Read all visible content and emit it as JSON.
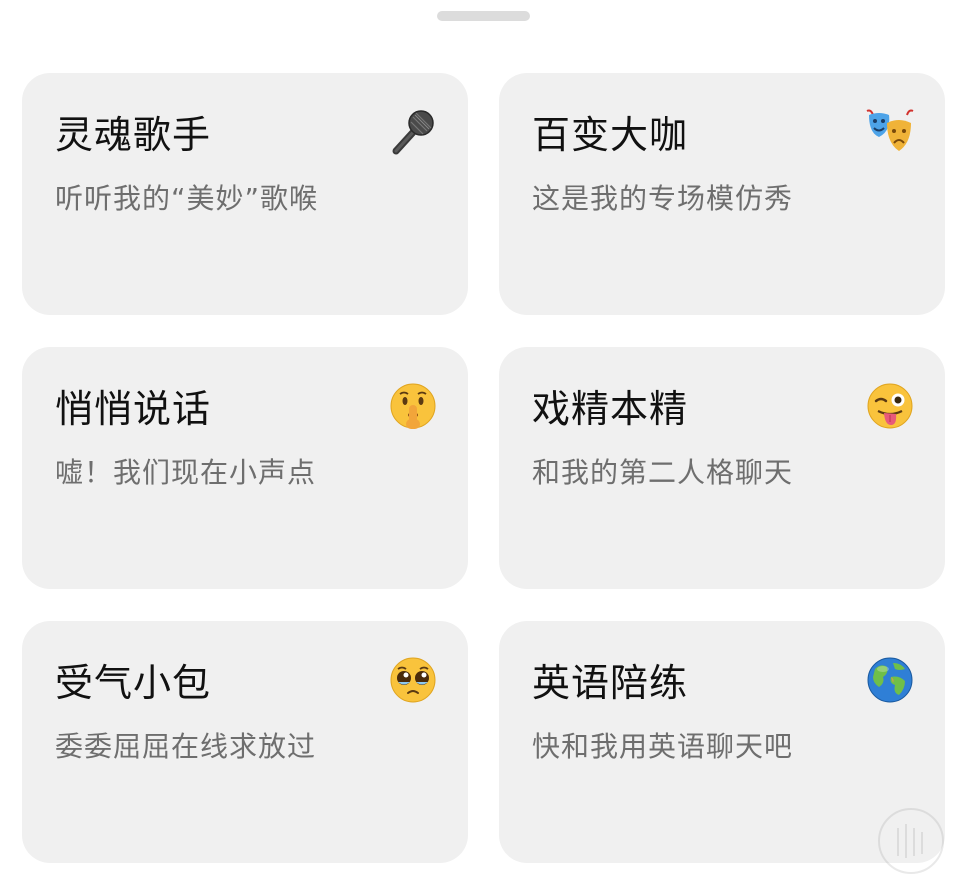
{
  "cards": [
    {
      "title": "灵魂歌手",
      "desc": "听听我的“美妙”歌喉",
      "icon": "microphone-icon"
    },
    {
      "title": "百变大咖",
      "desc": "这是我的专场模仿秀",
      "icon": "theater-masks-icon"
    },
    {
      "title": "悄悄说话",
      "desc": "嘘！我们现在小声点",
      "icon": "shushing-face-icon"
    },
    {
      "title": "戏精本精",
      "desc": "和我的第二人格聊天",
      "icon": "winking-tongue-face-icon"
    },
    {
      "title": "受气小包",
      "desc": "委委屈屈在线求放过",
      "icon": "pleading-face-icon"
    },
    {
      "title": "英语陪练",
      "desc": "快和我用英语聊天吧",
      "icon": "globe-icon"
    }
  ]
}
